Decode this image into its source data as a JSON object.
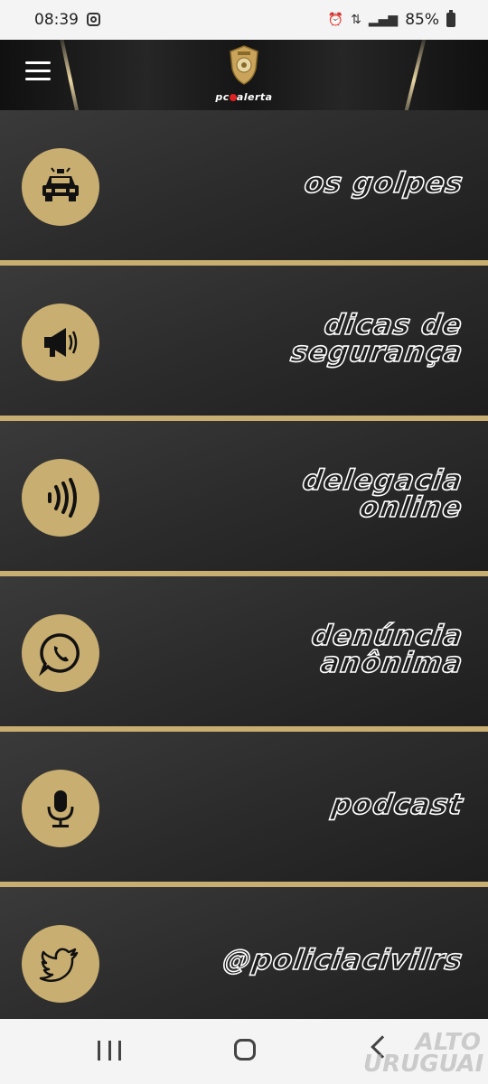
{
  "status_bar": {
    "time": "08:39",
    "battery": "85%"
  },
  "header": {
    "logo_text": "alerta",
    "logo_prefix": "pc"
  },
  "menu": [
    {
      "label_lines": [
        "os golpes"
      ],
      "icon": "police-car-icon"
    },
    {
      "label_lines": [
        "dicas de",
        "segurança"
      ],
      "icon": "megaphone-icon"
    },
    {
      "label_lines": [
        "delegacia",
        "online"
      ],
      "icon": "signal-waves-icon"
    },
    {
      "label_lines": [
        "denúncia",
        "anônima"
      ],
      "icon": "whatsapp-icon"
    },
    {
      "label_lines": [
        "podcast"
      ],
      "icon": "microphone-icon"
    },
    {
      "label_lines": [
        "@policiacivilrs"
      ],
      "icon": "twitter-icon"
    }
  ],
  "watermark": {
    "line1": "ALTO",
    "line2": "URUGUAI"
  },
  "colors": {
    "gold": "#c9ae71",
    "panel_dark": "#2b2b2b",
    "outline_text": "#ffffff"
  }
}
